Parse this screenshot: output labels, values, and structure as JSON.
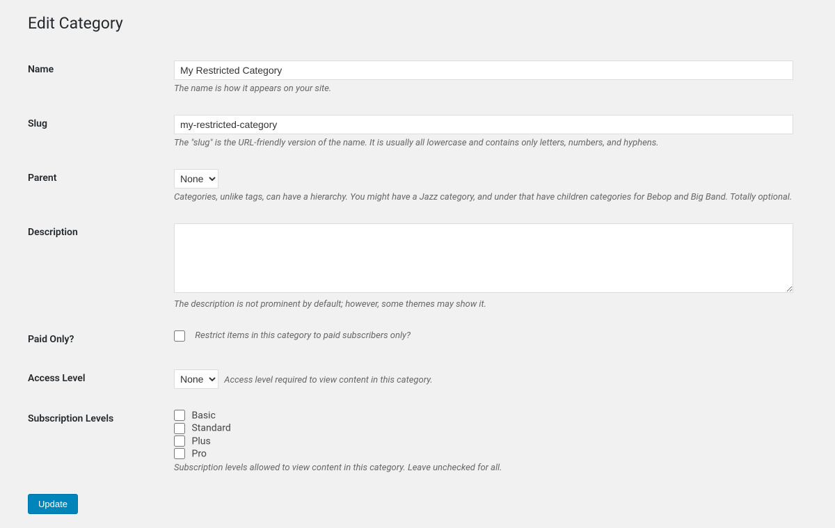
{
  "page": {
    "title": "Edit Category"
  },
  "fields": {
    "name": {
      "label": "Name",
      "value": "My Restricted Category",
      "description": "The name is how it appears on your site."
    },
    "slug": {
      "label": "Slug",
      "value": "my-restricted-category",
      "description": "The \"slug\" is the URL-friendly version of the name. It is usually all lowercase and contains only letters, numbers, and hyphens."
    },
    "parent": {
      "label": "Parent",
      "selected": "None",
      "description": "Categories, unlike tags, can have a hierarchy. You might have a Jazz category, and under that have children categories for Bebop and Big Band. Totally optional."
    },
    "description": {
      "label": "Description",
      "value": "",
      "description": "The description is not prominent by default; however, some themes may show it."
    },
    "paid_only": {
      "label": "Paid Only?",
      "description": "Restrict items in this category to paid subscribers only?"
    },
    "access_level": {
      "label": "Access Level",
      "selected": "None",
      "description": "Access level required to view content in this category."
    },
    "subscription_levels": {
      "label": "Subscription Levels",
      "options": [
        "Basic",
        "Standard",
        "Plus",
        "Pro"
      ],
      "description": "Subscription levels allowed to view content in this category. Leave unchecked for all."
    }
  },
  "buttons": {
    "update": "Update"
  }
}
